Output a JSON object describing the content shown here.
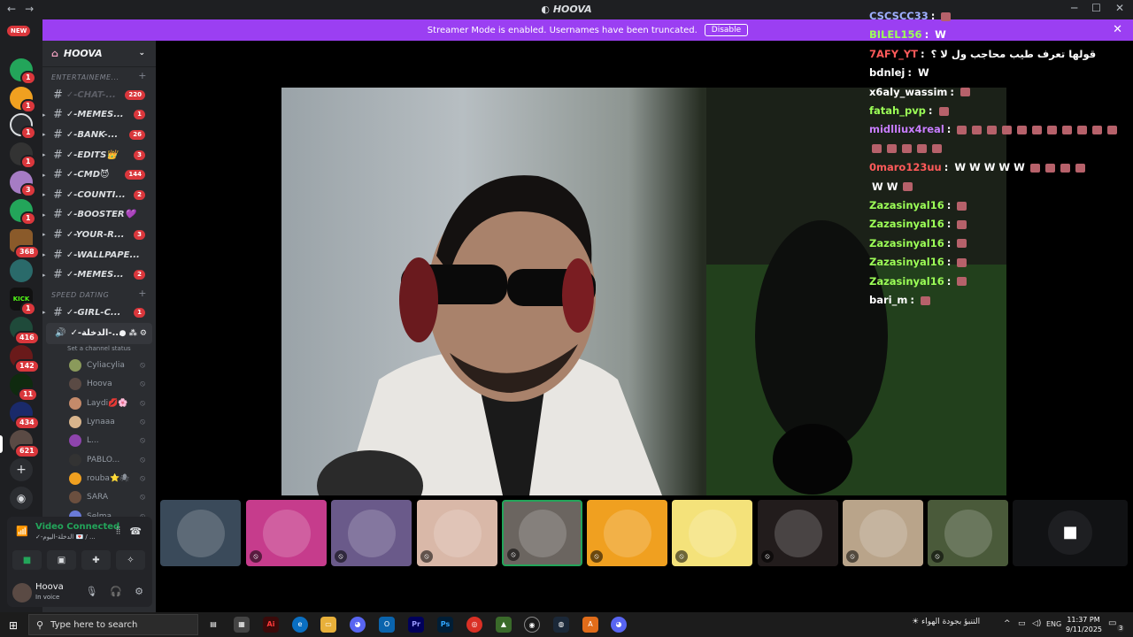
{
  "window": {
    "title": "HOOVA",
    "back": "←",
    "forward": "→"
  },
  "banner": {
    "text": "Streamer Mode is enabled. Usernames have been truncated.",
    "disable_label": "Disable"
  },
  "server_rail": {
    "new_badge": "NEW",
    "badges": [
      "1",
      "1",
      "1",
      "1",
      "3",
      "1",
      "368",
      "1",
      "416",
      "142",
      "11",
      "434",
      "621"
    ]
  },
  "server": {
    "name": "HOOVA",
    "categories": [
      {
        "name": "ENTERTAINEME...",
        "channels": [
          {
            "name": "✓-CHAT-...",
            "count": "220",
            "muted": true
          },
          {
            "name": "✓-MEMES...",
            "count": "1"
          },
          {
            "name": "✓-BANK-...",
            "count": "26"
          },
          {
            "name": "✓-EDITS👑",
            "count": "3"
          },
          {
            "name": "✓-CMD😈",
            "count": "144"
          },
          {
            "name": "✓-COUNTI...",
            "count": "2"
          },
          {
            "name": "✓-BOOSTER💜",
            "count": ""
          },
          {
            "name": "✓-YOUR-R...",
            "count": "3"
          },
          {
            "name": "✓-WALLPAPE...",
            "count": ""
          },
          {
            "name": "✓-MEMES...",
            "count": "2"
          }
        ]
      },
      {
        "name": "SPEED DATING",
        "channels": [
          {
            "name": "✓-GIRL-C...",
            "count": "1"
          }
        ]
      }
    ],
    "voice_channel": {
      "name": "✓-الدخلة-...",
      "status": "Set a channel status",
      "users": [
        {
          "name": "Cyliacylia",
          "color": "#8a9a5b"
        },
        {
          "name": "Hoova",
          "color": "#5a4a44"
        },
        {
          "name": "Laydi💋🌸",
          "color": "#c48a6a"
        },
        {
          "name": "Lynaaa",
          "color": "#d8b48c"
        },
        {
          "name": "L...",
          "color": "#8e44ad"
        },
        {
          "name": "PABLO...",
          "color": "#333333"
        },
        {
          "name": "rouba⭐🕷",
          "color": "#f0a020"
        },
        {
          "name": "SARA",
          "color": "#6b4f3f"
        },
        {
          "name": "Selma",
          "color": "#6a7ad8"
        }
      ]
    }
  },
  "voice_panel": {
    "status": "Video Connected",
    "channel": "✓-الدخلة-اليوم 💌 / ...",
    "user_name": "Hoova",
    "user_status": "In voice"
  },
  "chat": [
    {
      "user": "CSCSCC33",
      "color": "#9fb0ff",
      "msg": "",
      "emotes": 1
    },
    {
      "user": "BILEL156",
      "color": "#9cff57",
      "msg": "W",
      "emotes": 0
    },
    {
      "user": "7AFY_YT",
      "color": "#ff5a5a",
      "msg": "قولها تعرف طيب محاجب ول لا ؟",
      "emotes": 0
    },
    {
      "user": "bdnlej",
      "color": "#ffffff",
      "msg": "W",
      "emotes": 0
    },
    {
      "user": "x6aly_wassim",
      "color": "#ffffff",
      "msg": "",
      "emotes": 1
    },
    {
      "user": "fatah_pvp",
      "color": "#9cff57",
      "msg": "",
      "emotes": 1
    },
    {
      "user": "midlliux4real",
      "color": "#c77dff",
      "msg": "",
      "emotes": 11
    },
    {
      "user": "",
      "color": "#ffffff",
      "msg": "",
      "emotes": 5
    },
    {
      "user": "0maro123uu",
      "color": "#ff5a5a",
      "msg": "W  W  W  W  W",
      "emotes": 4
    },
    {
      "user": "",
      "color": "#ffffff",
      "msg": "W  W",
      "emotes": 1
    },
    {
      "user": "Zazasinyal16",
      "color": "#9cff57",
      "msg": "",
      "emotes": 1
    },
    {
      "user": "Zazasinyal16",
      "color": "#9cff57",
      "msg": "",
      "emotes": 1
    },
    {
      "user": "Zazasinyal16",
      "color": "#9cff57",
      "msg": "",
      "emotes": 1
    },
    {
      "user": "Zazasinyal16",
      "color": "#9cff57",
      "msg": "",
      "emotes": 1
    },
    {
      "user": "Zazasinyal16",
      "color": "#9cff57",
      "msg": "",
      "emotes": 1
    },
    {
      "user": "bari_m",
      "color": "#ffffff",
      "msg": "",
      "emotes": 1
    }
  ],
  "tiles": [
    {
      "color": "#3a4a5a",
      "mic_off": false
    },
    {
      "color": "#c63c8c",
      "mic_off": true
    },
    {
      "color": "#6a5a8a",
      "mic_off": true
    },
    {
      "color": "#d9b8a8",
      "mic_off": true
    },
    {
      "color": "#6b6560",
      "mic_off": true
    },
    {
      "color": "#f0a020",
      "mic_off": true
    },
    {
      "color": "#f4e27a",
      "mic_off": true
    },
    {
      "color": "#221c1c",
      "mic_off": true
    },
    {
      "color": "#b9a48a",
      "mic_off": true
    },
    {
      "color": "#4a5a3a",
      "mic_off": true
    }
  ],
  "taskbar": {
    "search_placeholder": "Type here to search",
    "weather": "التنبؤ بجودة الهواء",
    "lang": "ENG",
    "time": "11:37 PM",
    "date": "9/11/2025",
    "notif": "3"
  }
}
